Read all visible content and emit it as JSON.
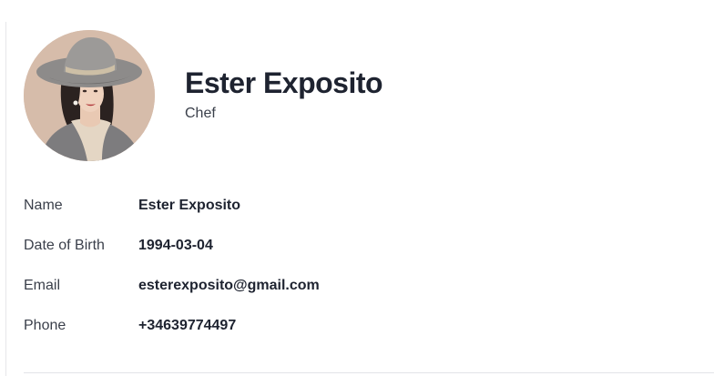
{
  "profile": {
    "name": "Ester Exposito",
    "role": "Chef"
  },
  "details": [
    {
      "label": "Name",
      "value": "Ester Exposito"
    },
    {
      "label": "Date of Birth",
      "value": "1994-03-04"
    },
    {
      "label": "Email",
      "value": "esterexposito@gmail.com"
    },
    {
      "label": "Phone",
      "value": "+34639774497"
    }
  ],
  "colors": {
    "text_primary": "#1e2330",
    "text_secondary": "#3a3f4a",
    "divider": "#e2e4e8",
    "avatar_background": "#d8bfae"
  },
  "icons": {
    "avatar": "woman-in-hat-portrait"
  }
}
